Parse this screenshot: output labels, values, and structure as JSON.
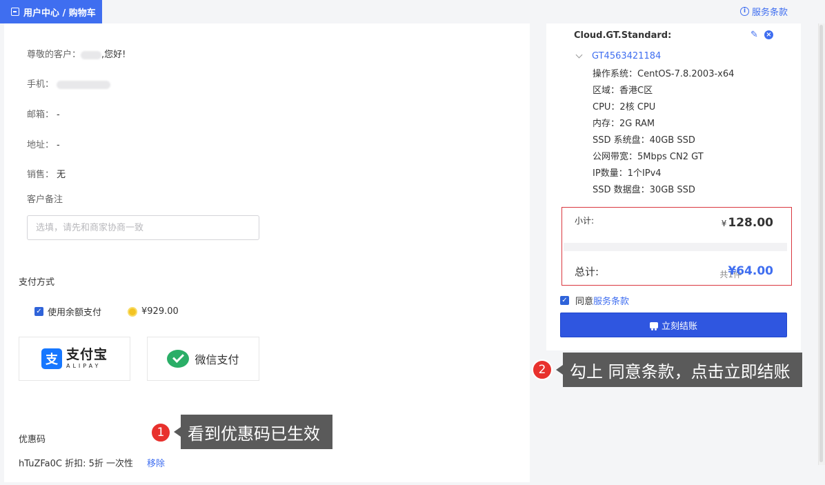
{
  "breadcrumb": {
    "text": "用户中心 / 购物车",
    "icon": "sign-in-icon"
  },
  "header": {
    "terms_link": "服务条款",
    "icon": "info-icon"
  },
  "customer": {
    "greeting_prefix": "尊敬的客户：",
    "greeting_suffix": ",您好!",
    "phone_label": "手机：",
    "email_label": "邮箱：",
    "email_value": "-",
    "address_label": "地址：",
    "address_value": "-",
    "sales_label": "销售：",
    "sales_value": "无",
    "remark_label": "客户备注",
    "remark_placeholder": "选填，请先和商家协商一致"
  },
  "payment": {
    "title": "支付方式",
    "use_balance_label": "使用余额支付",
    "balance_checked": true,
    "balance_amount": "¥929.00",
    "methods": [
      {
        "name": "支付宝",
        "subtitle": "ALIPAY",
        "icon": "alipay-icon"
      },
      {
        "name": "微信支付",
        "icon": "wechat-icon"
      }
    ]
  },
  "coupon": {
    "title": "优惠码",
    "code_text": "hTuZFa0C 折扣: 5折 一次性",
    "remove_label": "移除"
  },
  "order": {
    "product_name": "Cloud.GT.Standard:",
    "product_id": "GT4563421184",
    "specs": [
      "操作系统：CentOS-7.8.2003-x64",
      "区域：香港C区",
      "CPU：2核 CPU",
      "内存：2G RAM",
      "SSD 系统盘：40GB SSD",
      "公网带宽：5Mbps CN2 GT",
      "IP数量：1个IPv4",
      "SSD 数据盘：30GB SSD"
    ],
    "subtotal_label": "小计:",
    "subtotal_currency": "¥",
    "subtotal_value": "128.00",
    "total_label": "总计:",
    "total_count": "共1件",
    "total_value": "¥64.00",
    "agree_prefix": "同意",
    "agree_link": "服务条款",
    "agree_checked": true,
    "checkout_label": "立刻结账"
  },
  "annotations": [
    {
      "number": "1",
      "text": "看到优惠码已生效"
    },
    {
      "number": "2",
      "text": "勾上 同意条款，点击立即结账"
    }
  ],
  "colors": {
    "accent": "#3f6ef0",
    "highlight_border": "#d9363e",
    "callout_bg": "#5a5a5a",
    "step_badge": "#e8312d"
  }
}
